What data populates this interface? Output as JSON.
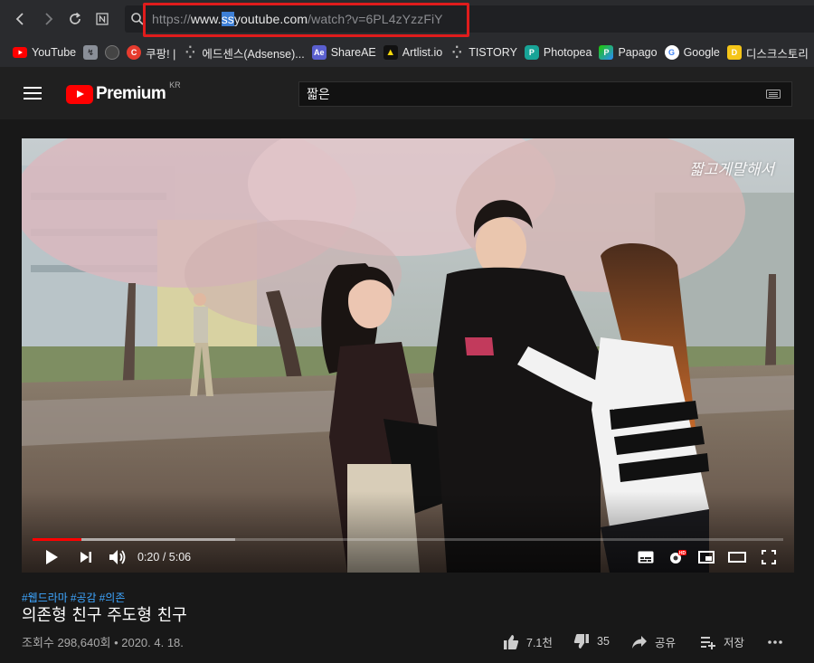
{
  "browser": {
    "url_scheme": "https://",
    "url_host_prefix": "www.",
    "url_selected": "ss",
    "url_host_rest": "youtube.com",
    "url_path": "/watch?v=6PL4zYzzFiY"
  },
  "bookmarks": [
    {
      "label": "YouTube",
      "icon": "youtube-icon",
      "color": "#ff0000"
    },
    {
      "label": "",
      "icon": "settings-bookmark-icon",
      "color": "#8a8f98"
    },
    {
      "label": "",
      "icon": "profile-bookmark-icon",
      "color": "#444444"
    },
    {
      "label": "쿠팡! |",
      "icon": "coupang-icon",
      "color": "#e63b2e"
    },
    {
      "label": "에드센스(Adsense)...",
      "icon": "dots-icon",
      "color": "#2a2b2e"
    },
    {
      "label": "ShareAE",
      "icon": "shareae-icon",
      "color": "#5a5fcf"
    },
    {
      "label": "Artlist.io",
      "icon": "artlist-icon",
      "color": "#111111"
    },
    {
      "label": "TISTORY",
      "icon": "tistory-icon",
      "color": "#2a2b2e"
    },
    {
      "label": "Photopea",
      "icon": "photopea-icon",
      "color": "#18a497"
    },
    {
      "label": "Papago",
      "icon": "papago-icon",
      "color": "#1ec800"
    },
    {
      "label": "Google",
      "icon": "google-icon",
      "color": "#ffffff"
    },
    {
      "label": "디스크스토리",
      "icon": "diskstory-icon",
      "color": "#f5c518"
    }
  ],
  "youtube": {
    "brand": "Premium",
    "country": "KR",
    "search_value": "짧은"
  },
  "video": {
    "overlay_text": "짧고게말해서",
    "time_current": "0:20",
    "time_separator": " / ",
    "time_total": "5:06",
    "progress_played_pct": 6.5,
    "progress_buffered_pct": 27
  },
  "info": {
    "hashtags": [
      "#웹드라마",
      "#공감",
      "#의존"
    ],
    "title": "의존형 친구 주도형 친구",
    "views": "조회수 298,640회",
    "date_sep": " • ",
    "date": "2020. 4. 18.",
    "like_count": "7.1천",
    "dislike_count": "35",
    "share_label": "공유",
    "save_label": "저장"
  }
}
